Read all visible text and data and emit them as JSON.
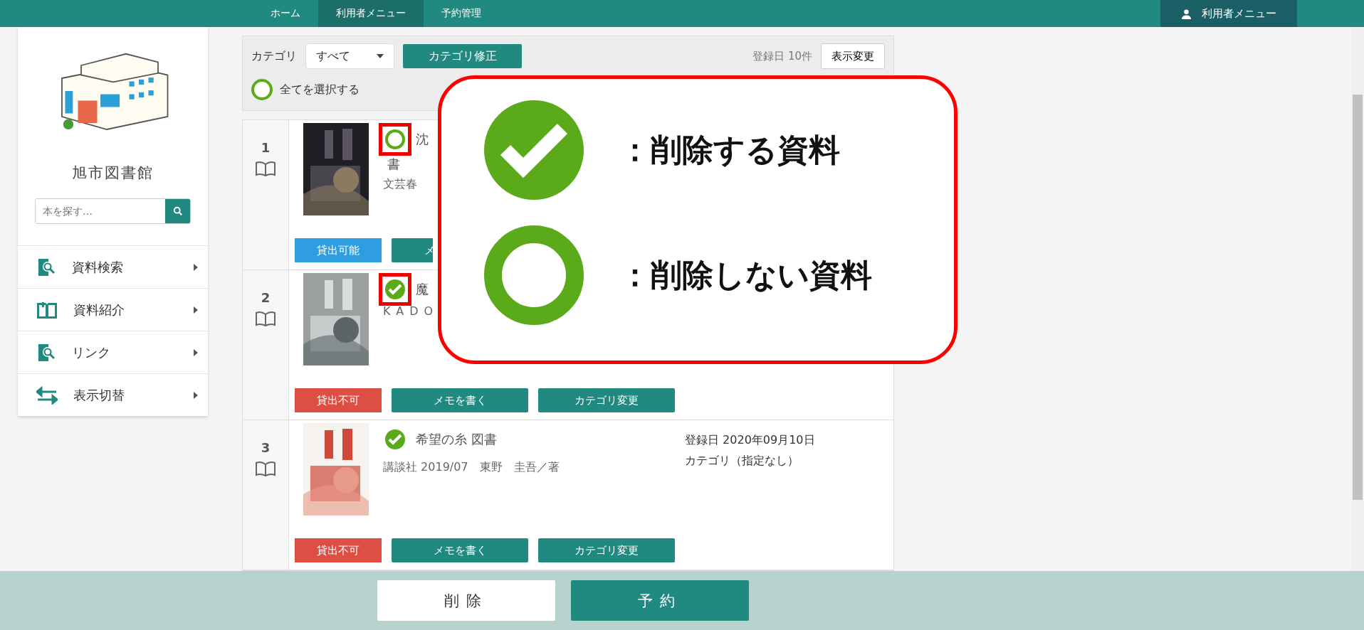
{
  "header": {
    "breadcrumbs": [
      {
        "label": "ホーム",
        "selected": false
      },
      {
        "label": "利用者メニュー",
        "selected": true
      },
      {
        "label": "予約管理",
        "selected": false
      }
    ],
    "user_menu": "利用者メニュー"
  },
  "sidebar": {
    "library_name": "旭市図書館",
    "search": {
      "placeholder": "本を探す…"
    },
    "items": [
      {
        "label": "資料検索",
        "kind": "search"
      },
      {
        "label": "資料紹介",
        "kind": "book"
      },
      {
        "label": "リンク",
        "kind": "search"
      },
      {
        "label": "表示切替",
        "kind": "switch"
      }
    ]
  },
  "toolbar": {
    "category_label": "カテゴリ",
    "category_value": "すべて",
    "fix_button": "カテゴリ修正",
    "count": "登録日 10件",
    "display_button": "表示変更",
    "select_all": {
      "label": "全てを選択する",
      "checked": false
    }
  },
  "items": [
    {
      "number": "1",
      "checked": false,
      "highlighted": true,
      "title_lines": [
        "沈",
        "書"
      ],
      "meta": "文芸春",
      "status": {
        "label": "貸出可能",
        "available": true
      },
      "buttons": [
        "メ"
      ]
    },
    {
      "number": "2",
      "checked": true,
      "highlighted": true,
      "title_lines": [
        "魔"
      ],
      "meta": "KADO",
      "status": {
        "label": "貸出不可",
        "available": false
      },
      "buttons": [
        "メモを書く",
        "カテゴリ変更"
      ]
    },
    {
      "number": "3",
      "checked": true,
      "highlighted": false,
      "title_lines": [
        "希望の糸 図書"
      ],
      "meta": "講談社 2019/07　東野　圭吾／著",
      "registered": "登録日 2020年09月10日",
      "category": "カテゴリ（指定なし）",
      "status": {
        "label": "貸出不可",
        "available": false
      },
      "buttons": [
        "メモを書く",
        "カテゴリ変更"
      ]
    }
  ],
  "callout": {
    "rows": [
      {
        "checked": true,
        "text": "：削除する資料"
      },
      {
        "checked": false,
        "text": "：削除しない資料"
      }
    ]
  },
  "footer": {
    "buttons": [
      {
        "label": "削除",
        "kind": "secondary"
      },
      {
        "label": "予約",
        "kind": "primary"
      }
    ]
  }
}
